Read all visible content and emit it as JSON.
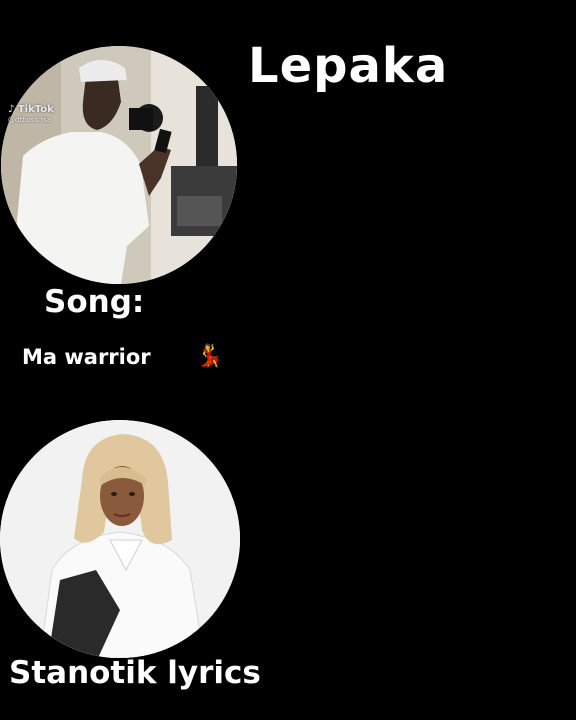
{
  "title": "Lepaka",
  "song_label": "Song:",
  "song_name": "Ma warrior",
  "song_icon": "💃",
  "credit": "Stanotik lyrics",
  "watermark": {
    "logo": "♪ TikTok",
    "handle": "@dtboss.rsa"
  },
  "images": {
    "top": "artist-in-studio-photo",
    "bottom": "singer-portrait-photo"
  },
  "colors": {
    "background": "#000000",
    "text": "#ffffff"
  }
}
